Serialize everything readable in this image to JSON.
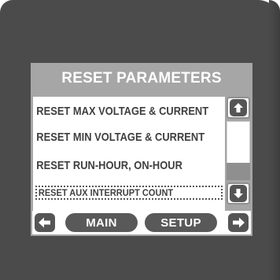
{
  "title": "RESET PARAMETERS",
  "items": [
    {
      "label": "RESET MAX VOLTAGE & CURRENT"
    },
    {
      "label": "RESET MIN VOLTAGE & CURRENT"
    },
    {
      "label": "RESET RUN-HOUR, ON-HOUR"
    },
    {
      "label": "RESET AUX INTERRUPT COUNT",
      "selected": true
    }
  ],
  "scrollbar": {
    "up_icon": "arrow-up-icon",
    "down_icon": "arrow-down-icon"
  },
  "nav": {
    "left_icon": "arrow-left-icon",
    "main_label": "MAIN",
    "setup_label": "SETUP",
    "right_icon": "arrow-right-icon"
  },
  "colors": {
    "bezel": "#4b4b4b",
    "screen": "#a6a6a6",
    "button": "#595959",
    "text": "#3f3f3f"
  }
}
